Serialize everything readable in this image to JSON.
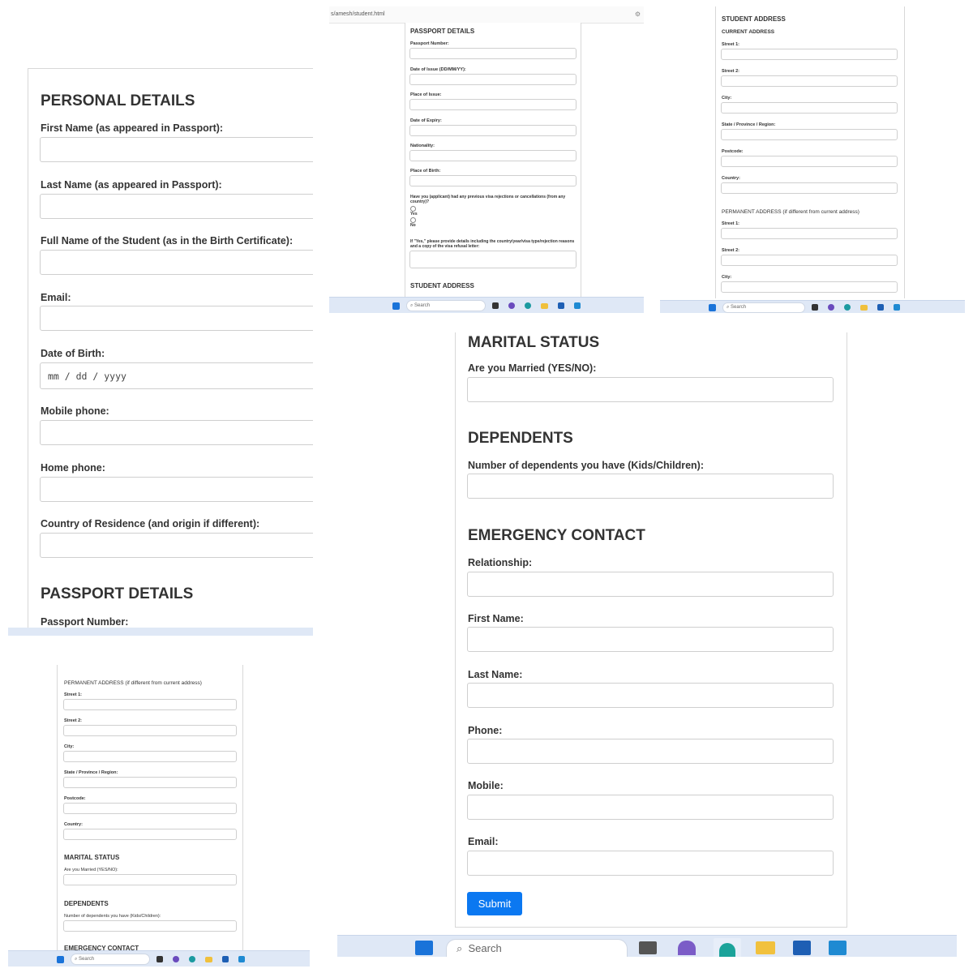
{
  "colors": {
    "accent": "#0b78f1",
    "taskbar": "#dfe8f6",
    "heading": "#333333"
  },
  "panel_a": {
    "personal_heading": "PERSONAL DETAILS",
    "fields": [
      {
        "label": "First Name (as appeared in Passport):"
      },
      {
        "label": "Last Name (as appeared in Passport):"
      },
      {
        "label": "Full Name of the Student (as in the Birth Certificate):"
      },
      {
        "label": "Email:"
      },
      {
        "label": "Date of Birth:",
        "placeholder": "mm / dd / yyyy"
      },
      {
        "label": "Mobile phone:"
      },
      {
        "label": "Home phone:"
      },
      {
        "label": "Country of Residence (and origin if different):"
      }
    ],
    "passport_heading": "PASSPORT DETAILS",
    "passport_number_label": "Passport Number:"
  },
  "panel_b": {
    "url": "s/amesh/student.html",
    "heading": "PASSPORT DETAILS",
    "fields": [
      {
        "label": "Passport Number:"
      },
      {
        "label": "Date of Issue (DD/MM/YY):"
      },
      {
        "label": "Place of Issue:"
      },
      {
        "label": "Date of Expiry:"
      },
      {
        "label": "Nationality:"
      },
      {
        "label": "Place of Birth:"
      }
    ],
    "question": "Have you (applicant) had any previous visa rejections or cancellations (from any country)?",
    "yes": "Yes",
    "no": "No",
    "details_label": "If \"Yes,\" please provide details including the country/year/visa type/rejection reasons and a copy of the visa refusal letter:",
    "next_heading": "STUDENT ADDRESS",
    "search": "Search"
  },
  "panel_c": {
    "heading": "STUDENT ADDRESS",
    "current_heading": "CURRENT ADDRESS",
    "current_fields": [
      {
        "label": "Street 1:"
      },
      {
        "label": "Street 2:"
      },
      {
        "label": "City:"
      },
      {
        "label": "State / Province / Region:"
      },
      {
        "label": "Postcode:"
      },
      {
        "label": "Country:"
      }
    ],
    "permanent_heading": "PERMANENT ADDRESS (if different from current address)",
    "permanent_fields": [
      {
        "label": "Street 1:"
      },
      {
        "label": "Street 2:"
      },
      {
        "label": "City:"
      }
    ],
    "search": "Search"
  },
  "panel_d": {
    "permanent_heading": "PERMANENT ADDRESS (if different from current address)",
    "permanent_fields": [
      {
        "label": "Street 1:"
      },
      {
        "label": "Street 2:"
      },
      {
        "label": "City:"
      },
      {
        "label": "State / Province / Region:"
      },
      {
        "label": "Postcode:"
      },
      {
        "label": "Country:"
      }
    ],
    "marital_heading": "MARITAL STATUS",
    "marital_label": "Are you Married (YES/NO):",
    "dependents_heading": "DEPENDENTS",
    "dependents_label": "Number of dependents you have (Kids/Children):",
    "emergency_heading": "EMERGENCY CONTACT",
    "search": "Search"
  },
  "panel_e": {
    "marital_heading": "MARITAL STATUS",
    "marital_label": "Are you Married (YES/NO):",
    "dependents_heading": "DEPENDENTS",
    "dependents_label": "Number of dependents you have (Kids/Children):",
    "emergency_heading": "EMERGENCY CONTACT",
    "emergency_fields": [
      {
        "label": "Relationship:"
      },
      {
        "label": "First Name:"
      },
      {
        "label": "Last Name:"
      },
      {
        "label": "Phone:"
      },
      {
        "label": "Mobile:"
      },
      {
        "label": "Email:"
      }
    ],
    "submit": "Submit",
    "search": "Search"
  }
}
